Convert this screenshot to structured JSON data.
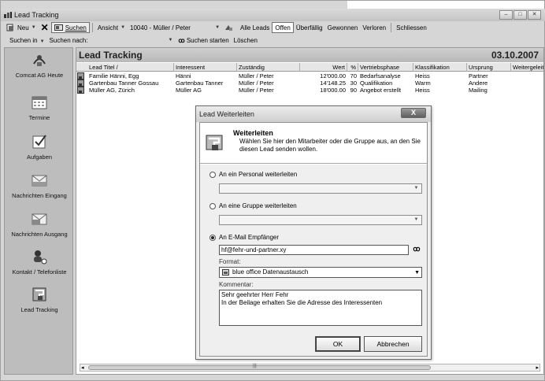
{
  "window": {
    "title": "Lead Tracking"
  },
  "toolbar": {
    "neu": "Neu",
    "suchen": "Suchen",
    "ansicht": "Ansicht",
    "ansicht_value": "10040 - Müller / Peter",
    "alle_leads": "Alle Leads",
    "offen": "Offen",
    "ueberfaellig": "Überfällig",
    "gewonnen": "Gewonnen",
    "verloren": "Verloren",
    "schliessen": "Schliessen"
  },
  "searchbar": {
    "suchen_in": "Suchen in",
    "suchen_nach": "Suchen nach:",
    "suchen_starten": "Suchen starten",
    "loeschen": "Löschen"
  },
  "sidebar": {
    "items": [
      {
        "label": "Comcat AG Heute",
        "icon": "organizer-icon"
      },
      {
        "label": "Termine",
        "icon": "calendar-icon"
      },
      {
        "label": "Aufgaben",
        "icon": "checkbox-task-icon"
      },
      {
        "label": "Nachrichten Eingang",
        "icon": "inbox-icon"
      },
      {
        "label": "Nachrichten Ausgang",
        "icon": "outbox-icon"
      },
      {
        "label": "Kontakt / Telefonliste",
        "icon": "contact-icon"
      },
      {
        "label": "Lead Tracking",
        "icon": "lead-tracking-icon"
      }
    ]
  },
  "content": {
    "title": "Lead Tracking",
    "date": "03.10.2007",
    "columns": [
      "Lead Titel /",
      "Interessent",
      "Zuständig",
      "Wert",
      "%",
      "Vertriebsphase",
      "Klassifikation",
      "Ursprung",
      "Weitergeleitet an"
    ],
    "rows": [
      [
        "Familie Hänni, Egg",
        "Hänni",
        "Müller / Peter",
        "12'000.00",
        "70",
        "Bedarfsanalyse",
        "Heiss",
        "Partner",
        ""
      ],
      [
        "Gartenbau Tanner Gossau",
        "Gartenbau Tanner",
        "Müller / Peter",
        "14'148.25",
        "30",
        "Qualifikation",
        "Warm",
        "Andere",
        ""
      ],
      [
        "Müller AG, Zürich",
        "Müller AG",
        "Müller / Peter",
        "18'000.00",
        "90",
        "Angebot erstellt",
        "Heiss",
        "Mailing",
        ""
      ]
    ],
    "scroll_mid": "|||"
  },
  "dialog": {
    "title": "Lead Weiterleiten",
    "close": "X",
    "heading": "Weiterleiten",
    "description": "Wählen Sie hier den Mitarbeiter oder die Gruppe aus, an den Sie diesen Lead senden wollen.",
    "opt_personal": "An ein Personal weiterleiten",
    "opt_gruppe": "An eine Gruppe weiterleiten",
    "opt_email": "An E-Mail Empfänger",
    "email_value": "hf@fehr-und-partner.xy",
    "format_label": "Format:",
    "format_value": "blue office Datenaustausch",
    "kommentar_label": "Kommentar:",
    "kommentar_line1": "Sehr geehrter Herr Fehr",
    "kommentar_line2": "In der Beilage erhalten Sie die Adresse des Interessenten",
    "ok": "OK",
    "abbrechen": "Abbrechen"
  }
}
